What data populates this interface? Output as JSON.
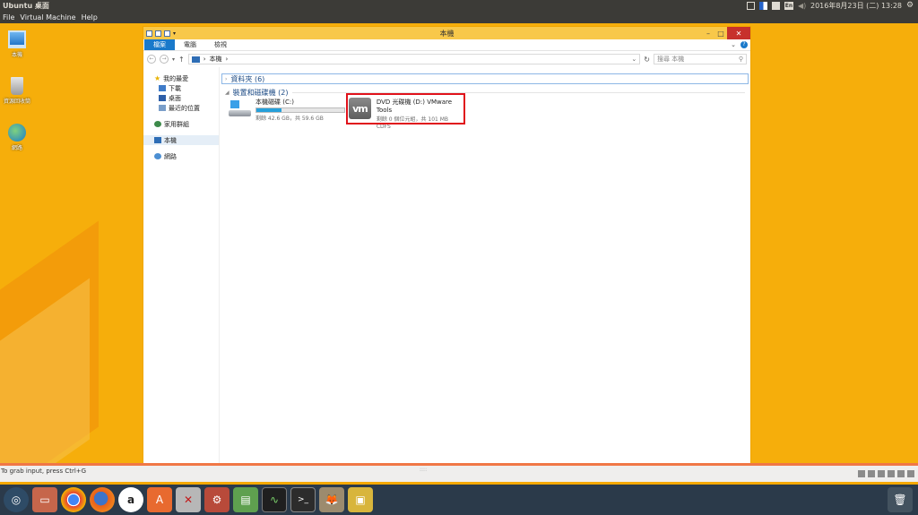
{
  "top_panel": {
    "title": "Ubuntu 桌面",
    "keyboard_indicator": "En",
    "clock": "2016年8月23日 (二) 13:28",
    "icons": [
      "mail-icon",
      "flag-icon",
      "doc-icon",
      "keyboard-icon",
      "volume-icon",
      "gear-icon"
    ]
  },
  "vm_menu": [
    "File",
    "Virtual Machine",
    "Help"
  ],
  "desktop_icons": [
    {
      "label": "本機",
      "icon": "computer-icon"
    },
    {
      "label": "資源回收筒",
      "icon": "recycle-bin-icon"
    },
    {
      "label": "網路",
      "icon": "network-icon"
    }
  ],
  "explorer": {
    "title": "本機",
    "ribbon_tabs": [
      "檔案",
      "電腦",
      "檢視"
    ],
    "address": {
      "path": "本機",
      "separator": "›"
    },
    "search_placeholder": "搜尋 本機",
    "nav": {
      "favorites": "我的最愛",
      "downloads": "下載",
      "desktop": "桌面",
      "recent": "最近的位置",
      "homegroup": "家用群組",
      "thispc": "本機",
      "network": "網路"
    },
    "groups": {
      "folders": "資料夾 (6)",
      "devices": "裝置和磁碟機 (2)"
    },
    "drives": [
      {
        "name": "本機磁碟 (C:)",
        "detail": "剩餘 42.6 GB，共 59.6 GB",
        "used_fraction": 0.29
      },
      {
        "name": "DVD 光碟機 (D:) VMware Tools",
        "detail": "剩餘 0 個位元組，共 101 MB",
        "fs": "CDFS",
        "icon_text": "vm"
      }
    ]
  },
  "vm_status": {
    "hint": "To grab input, press Ctrl+G"
  },
  "launcher": [
    "ubuntu-dash",
    "files",
    "chrome",
    "firefox",
    "amazon",
    "software-center",
    "system-tools",
    "settings",
    "disks",
    "system-monitor",
    "terminal",
    "gimp",
    "vmware",
    "trash"
  ]
}
